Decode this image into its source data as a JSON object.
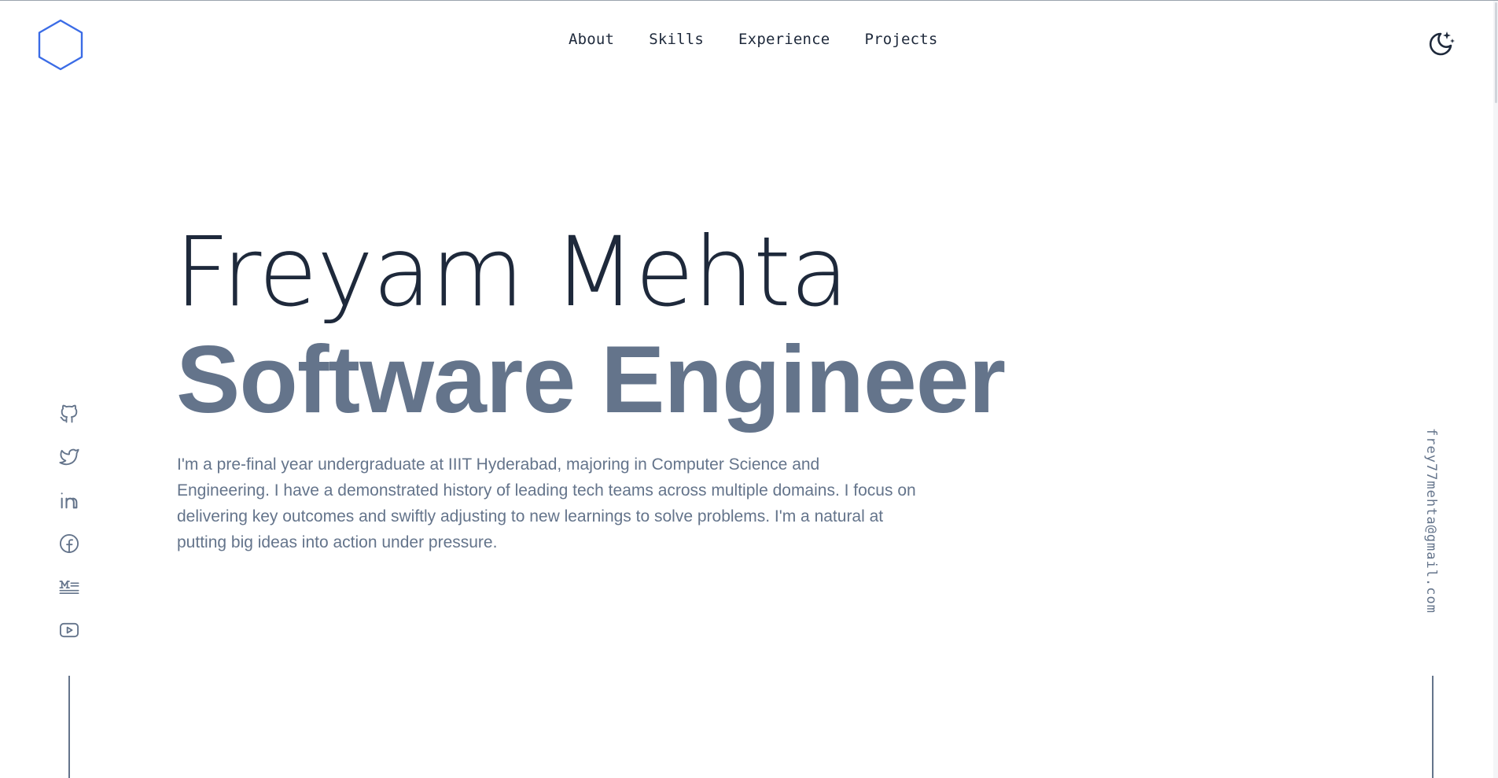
{
  "header": {
    "logo_icon": "hexagon-logo-icon",
    "nav": [
      {
        "label": "About"
      },
      {
        "label": "Skills"
      },
      {
        "label": "Experience"
      },
      {
        "label": "Projects"
      }
    ],
    "theme_toggle_icon": "moon-stars-icon"
  },
  "hero": {
    "name": "Freyam Mehta",
    "role": "Software Engineer",
    "bio": "I'm a pre-final year undergraduate at IIIT Hyderabad, majoring in Computer Science and Engineering. I have a demonstrated history of leading tech teams across multiple domains. I focus on delivering key outcomes and swiftly adjusting to new learnings to solve problems. I'm a natural at putting big ideas into action under pressure."
  },
  "social": {
    "icons": [
      "github-icon",
      "twitter-icon",
      "linkedin-icon",
      "facebook-icon",
      "medium-icon",
      "youtube-icon"
    ]
  },
  "email": {
    "address": "frey77mehta@gmail.com"
  },
  "colors": {
    "accent": "#3b6ce6",
    "text_dark": "#1e293b",
    "text_muted": "#64748b",
    "background": "#ffffff"
  }
}
